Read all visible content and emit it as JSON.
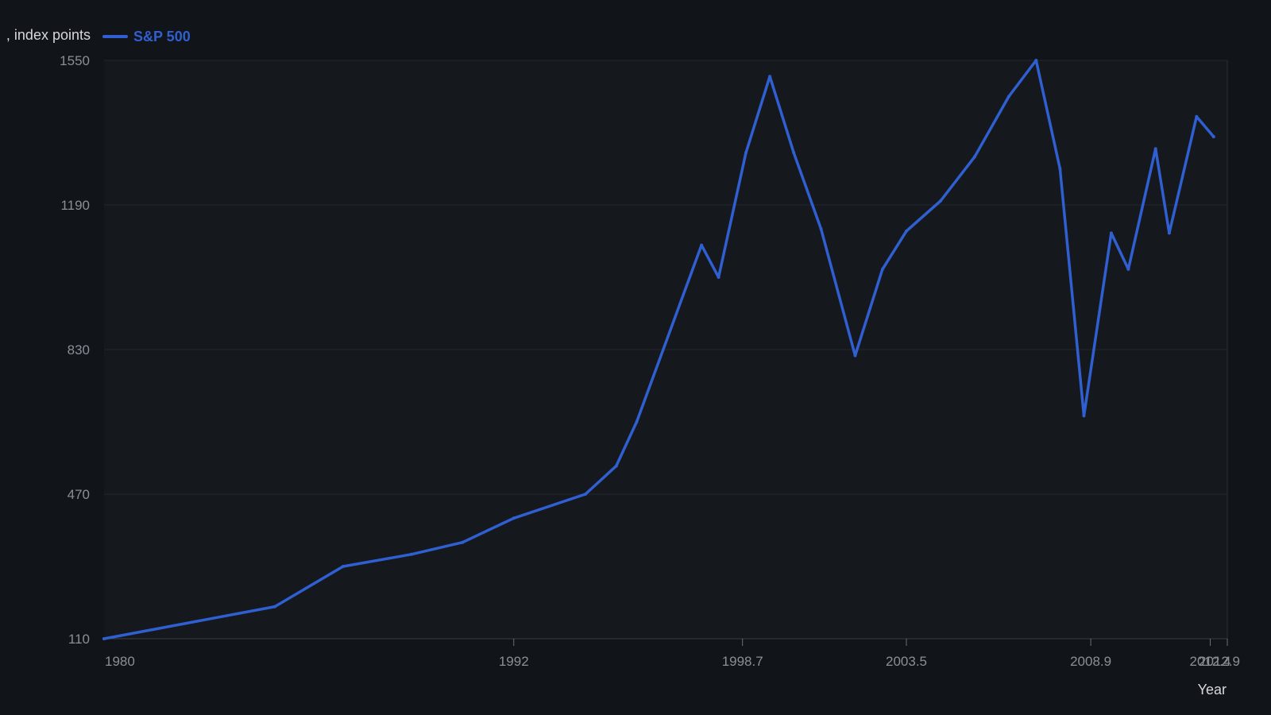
{
  "chart_data": {
    "type": "line",
    "title": "",
    "ylabel": ", index points",
    "xlabel": "Year",
    "legend_position": "top-left",
    "grid": true,
    "xlim": [
      1980,
      2012.9
    ],
    "ylim": [
      110,
      1550
    ],
    "x_ticks": [
      {
        "value": 1980,
        "label": "1980"
      },
      {
        "value": 1992,
        "label": "1992"
      },
      {
        "value": 1998.7,
        "label": "1998.7"
      },
      {
        "value": 2003.5,
        "label": "2003.5"
      },
      {
        "value": 2008.9,
        "label": "2008.9"
      },
      {
        "value": 2012.4,
        "label": "2012.4"
      },
      {
        "value": 2012.9,
        "label": "2012.9"
      }
    ],
    "y_ticks": [
      110,
      470,
      830,
      1190,
      1550
    ],
    "series": [
      {
        "name": "S&P 500",
        "color": "#2f5fd0",
        "x": [
          1980,
          1985,
          1987,
          1989,
          1990.5,
          1992,
          1994.1,
          1995,
          1995.6,
          1997.5,
          1998,
          1998.8,
          1999.5,
          2000.2,
          2001,
          2002,
          2002.8,
          2003.5,
          2004.5,
          2005.5,
          2006.5,
          2007.3,
          2008,
          2008.7,
          2009.5,
          2010,
          2010.8,
          2011.2,
          2012,
          2012.5
        ],
        "values": [
          110,
          190,
          290,
          320,
          350,
          410,
          470,
          540,
          650,
          1090,
          1010,
          1320,
          1510,
          1320,
          1130,
          815,
          1030,
          1125,
          1200,
          1310,
          1460,
          1550,
          1280,
          665,
          1120,
          1030,
          1330,
          1120,
          1410,
          1360
        ]
      }
    ]
  }
}
